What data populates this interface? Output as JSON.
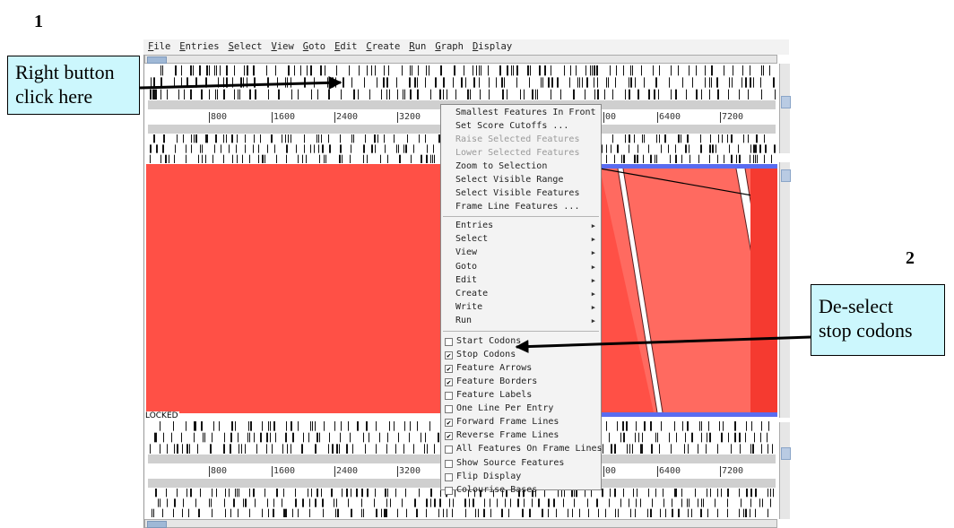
{
  "annotations": {
    "step1": "1",
    "step2": "2",
    "callout1": [
      "Right button",
      "click here"
    ],
    "callout2": [
      "De-select",
      "stop codons"
    ],
    "color_callout_bg": "#ccf7fd"
  },
  "menubar": [
    "File",
    "Entries",
    "Select",
    "View",
    "Goto",
    "Edit",
    "Create",
    "Run",
    "Graph",
    "Display"
  ],
  "ruler": {
    "labels": [
      "800",
      "1600",
      "2400",
      "3200",
      "00",
      "6400",
      "7200"
    ]
  },
  "status": {
    "locked": "LOCKED"
  },
  "context_menu": {
    "top_items": [
      {
        "label": "Smallest Features In Front",
        "enabled": true
      },
      {
        "label": "Set Score Cutoffs ...",
        "enabled": true
      },
      {
        "label": "Raise Selected Features",
        "enabled": false
      },
      {
        "label": "Lower Selected Features",
        "enabled": false
      },
      {
        "label": "Zoom to Selection",
        "enabled": true
      },
      {
        "label": "Select Visible Range",
        "enabled": true
      },
      {
        "label": "Select Visible Features",
        "enabled": true
      },
      {
        "label": "Frame Line Features ...",
        "enabled": true
      }
    ],
    "submenus": [
      "Entries",
      "Select",
      "View",
      "Goto",
      "Edit",
      "Create",
      "Write",
      "Run"
    ],
    "checkboxes": [
      {
        "label": "Start Codons",
        "checked": false
      },
      {
        "label": "Stop Codons",
        "checked": true
      },
      {
        "label": "Feature Arrows",
        "checked": true
      },
      {
        "label": "Feature Borders",
        "checked": true
      },
      {
        "label": "Feature Labels",
        "checked": false
      },
      {
        "label": "One Line Per Entry",
        "checked": false
      },
      {
        "label": "Forward Frame Lines",
        "checked": true
      },
      {
        "label": "Reverse Frame Lines",
        "checked": true
      },
      {
        "label": "All Features On Frame Lines",
        "checked": false
      },
      {
        "label": "Show Source Features",
        "checked": false
      },
      {
        "label": "Flip Display",
        "checked": false
      },
      {
        "label": "Colourise Bases",
        "checked": false
      }
    ]
  },
  "colors": {
    "feature_red": "#ff5046",
    "frame_blue": "#5a6cf0"
  }
}
